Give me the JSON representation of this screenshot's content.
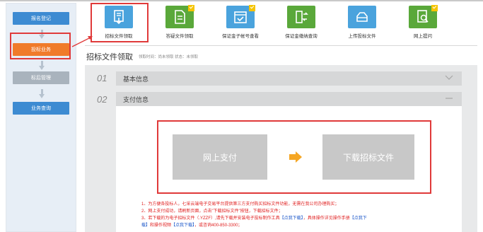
{
  "sidebar": {
    "items": [
      {
        "label": "报名登记"
      },
      {
        "label": "投标业务"
      },
      {
        "label": "标后管理"
      },
      {
        "label": "业务查询"
      }
    ]
  },
  "toolbar": {
    "items": [
      {
        "label": "招标文件领取",
        "icon": "document-download-icon",
        "color": "#4aa3dd"
      },
      {
        "label": "答疑文件领取",
        "icon": "document-icon",
        "color": "#5aa83a"
      },
      {
        "label": "保证金子帐号查看",
        "icon": "calendar-check-icon",
        "color": "#4aa3dd"
      },
      {
        "label": "保证金缴纳查询",
        "icon": "transfer-icon",
        "color": "#5aa83a"
      },
      {
        "label": "上传投标文件",
        "icon": "cloud-upload-icon",
        "color": "#4aa3dd"
      },
      {
        "label": "网上提问",
        "icon": "search-document-icon",
        "color": "#5aa83a"
      }
    ]
  },
  "header": {
    "title": "招标文件领取",
    "meta": "领取时间：尚未领取  状态：未领取"
  },
  "sections": [
    {
      "num": "01",
      "title": "基本信息",
      "icon": "chevron-down-icon"
    },
    {
      "num": "02",
      "title": "支付信息",
      "icon": "collapse-icon"
    }
  ],
  "payment": {
    "pay_label": "网上支付",
    "download_label": "下载招标文件",
    "arrow_color": "#f5a623"
  },
  "notes": {
    "line1": "1、为方便各投标人，七采云端电子交易平台提供第三方支付购买招标文件功能，无需在我公司办理购买；",
    "line2": "2、网上支付成功，请刷新页面，点击\"下载招标文件\"按钮，下载招标文件；",
    "line3a": "3、若下载的为电子招标文件（.YZZF）,请先下载并安装电子投标制作工具",
    "link1": "【点我下载】",
    "line3b": "，具体操作详见操作手册",
    "link2": "【点我下",
    "line4a": "载】",
    "line4b": "和操作视频",
    "link3": "【点我下载】",
    "line4c": "，或咨询400-850-3300；"
  },
  "colors": {
    "accent_red": "#e03a3a",
    "sidebar_active": "#f07b2a",
    "sidebar_blue": "#3d8bd2"
  }
}
